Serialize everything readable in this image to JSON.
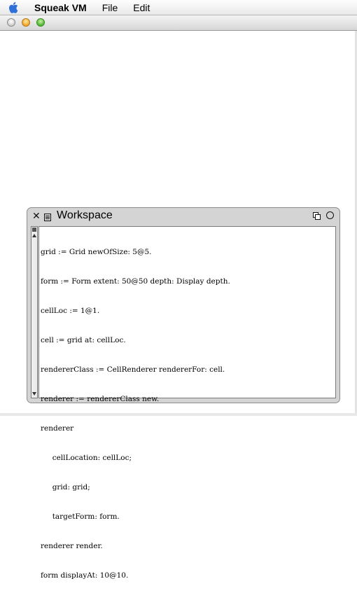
{
  "menubar": {
    "app_name": "Squeak VM",
    "items": [
      "File",
      "Edit"
    ]
  },
  "workspace": {
    "title": "Workspace",
    "lines": [
      "grid := Grid newOfSize: 5@5.",
      "form := Form extent: 50@50 depth: Display depth.",
      "cellLoc := 1@1.",
      "cell := grid at: cellLoc.",
      "rendererClass := CellRenderer rendererFor: cell.",
      "renderer := rendererClass new.",
      "renderer",
      "     cellLocation: cellLoc;",
      "     grid: grid;",
      "     targetForm: form.",
      "renderer render.",
      "form displayAt: 10@10."
    ]
  },
  "icons": {
    "apple": "apple-icon",
    "close": "close-icon",
    "window_menu": "window-menu-icon",
    "collapse": "collapse-icon",
    "expand": "expand-icon"
  }
}
